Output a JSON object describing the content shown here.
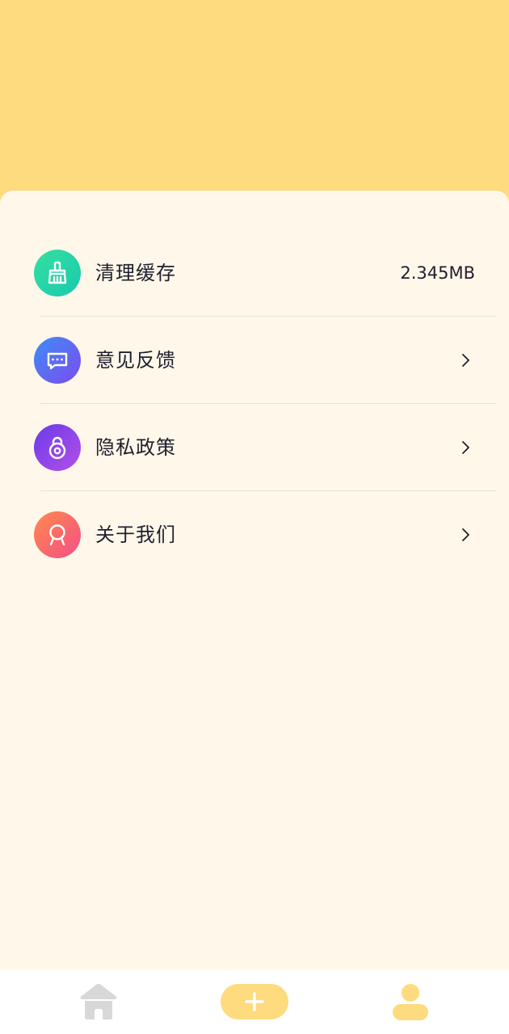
{
  "colors": {
    "header_background": "#FDDB7E",
    "card_background": "#FFF8EA",
    "text_primary": "#1F1F2E",
    "divider": "#E4E1DA",
    "tab_inactive": "#D8D8D8",
    "tab_active": "#FDDB7E"
  },
  "settings": {
    "items": [
      {
        "label": "清理缓存",
        "value": "2.345MB",
        "icon": "broom-icon",
        "trailing": "value"
      },
      {
        "label": "意见反馈",
        "icon": "chat-bubble-icon",
        "trailing": "chevron-right-icon"
      },
      {
        "label": "隐私政策",
        "icon": "lock-icon",
        "trailing": "chevron-right-icon"
      },
      {
        "label": "关于我们",
        "icon": "award-ribbon-icon",
        "trailing": "chevron-right-icon"
      }
    ]
  },
  "tab_bar": {
    "tabs": [
      {
        "icon": "home-icon",
        "active": false
      },
      {
        "icon": "plus-icon",
        "active": false
      },
      {
        "icon": "user-icon",
        "active": true
      }
    ]
  }
}
